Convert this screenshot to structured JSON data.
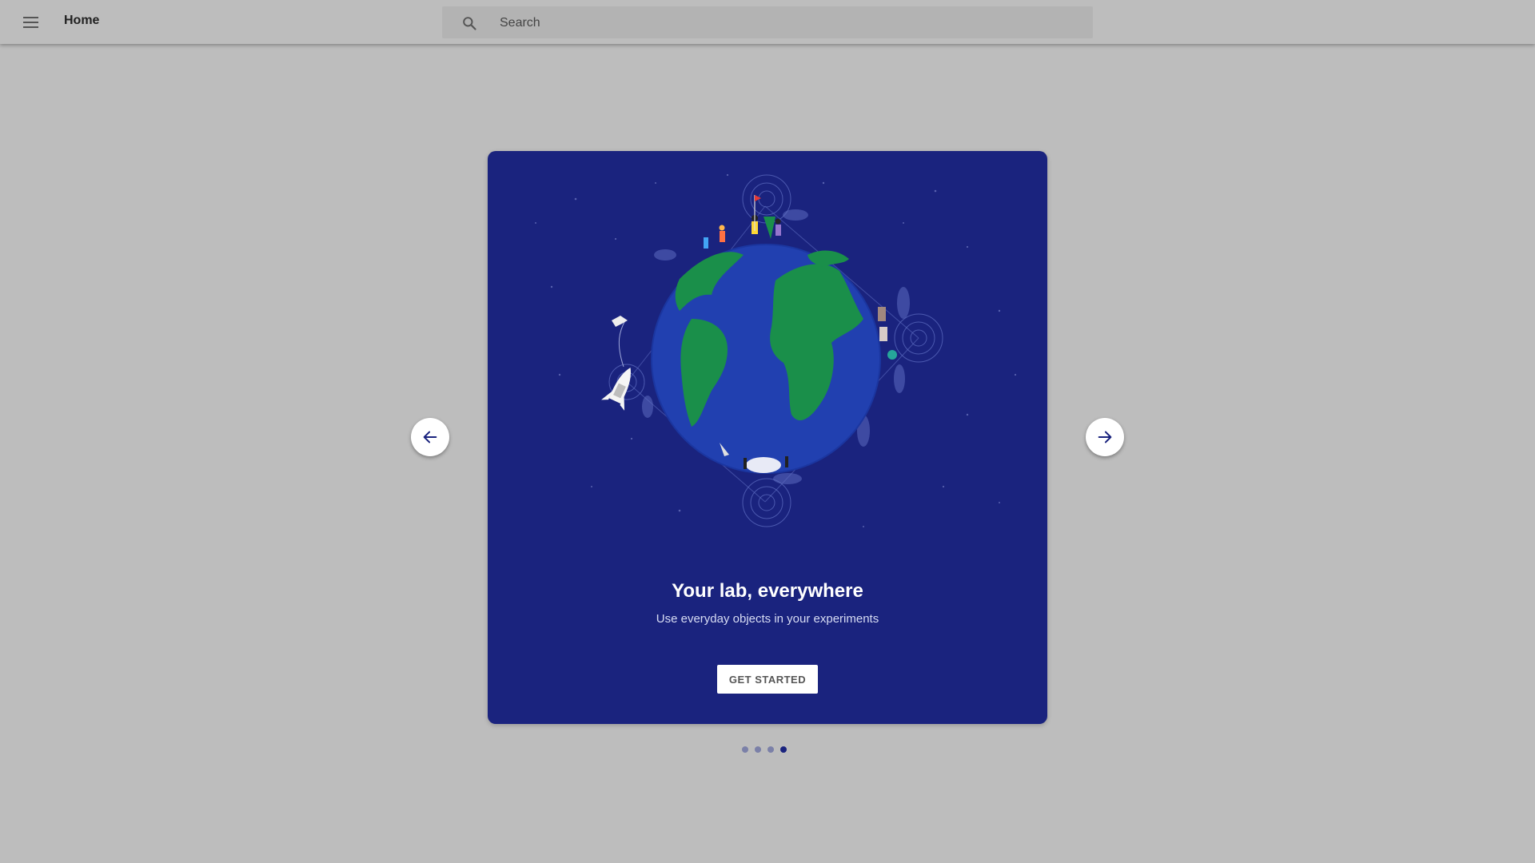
{
  "header": {
    "menu_icon": "hamburger-menu-icon",
    "title": "Home",
    "search": {
      "icon": "search-icon",
      "placeholder": "Search",
      "value": ""
    }
  },
  "carousel": {
    "slide": {
      "title": "Your lab, everywhere",
      "subtitle": "Use everyday objects in your experiments",
      "button_label": "GET STARTED",
      "illustration": "globe-with-people-and-rocket"
    },
    "prev_icon": "arrow-left-icon",
    "next_icon": "arrow-right-icon",
    "slide_count": 4,
    "active_index": 4
  },
  "colors": {
    "page_background": "#bdbdbd",
    "card_background": "#1a237e",
    "ocean": "#2140b0",
    "land": "#1a8f4a",
    "dot_inactive": "#7b80a8",
    "dot_active": "#1a237e"
  }
}
